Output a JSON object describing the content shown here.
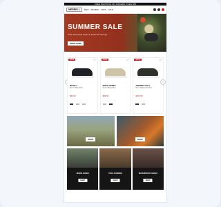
{
  "topbar": {
    "text": "FREE SHIPPING ON ORDERS OVER $50"
  },
  "nav": {
    "brand": "MERRELL",
    "links": [
      "MEN",
      "WOMEN",
      "KIDS",
      "SALE"
    ]
  },
  "hero": {
    "title": "SUMMER SALE",
    "subtitle": "Shop trail-ready styles at seasonal savings.",
    "button": "SHOP NOW"
  },
  "products": [
    {
      "badge": "SALE",
      "name": "MOAB 3",
      "desc": "Men's Hiking Shoe",
      "price": "$99.99",
      "color": "black"
    },
    {
      "badge": "SALE",
      "name": "MOAB SPEED",
      "desc": "Men's Hiking Shoe",
      "price": "$89.99",
      "color": "tan"
    },
    {
      "badge": "SALE",
      "name": "THERMO CHILL",
      "desc": "Men's Waterproof Shoe",
      "price": "$109.99",
      "color": "olive"
    }
  ],
  "banners": [
    {
      "button": "SHOP"
    },
    {
      "button": "SHOP"
    }
  ],
  "tiles": [
    {
      "name": "HIKING SHOES",
      "button": "SHOP"
    },
    {
      "name": "TRAIL RUNNING",
      "button": "SHOP"
    },
    {
      "name": "WATERPROOF SHOES",
      "button": "SHOP"
    }
  ]
}
